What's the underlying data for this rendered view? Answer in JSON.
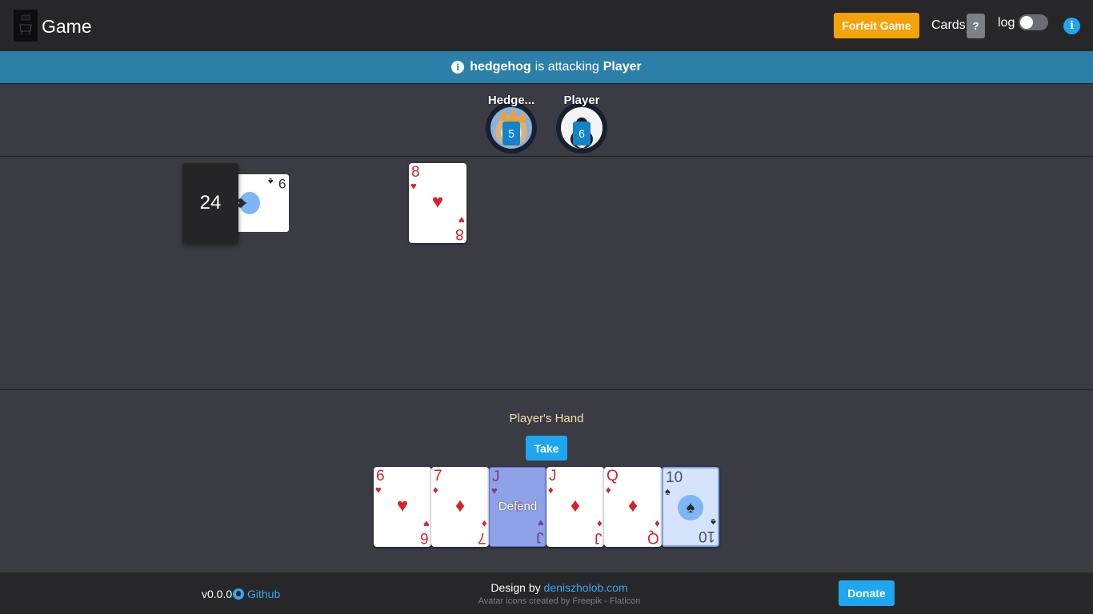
{
  "header": {
    "title": "Game",
    "forfeit_label": "Forfeit Game",
    "cards_label": "Cards",
    "cards_help": "?",
    "log_label": "log",
    "log_enabled": false,
    "info_icon": "info-icon"
  },
  "status": {
    "icon": "info-icon",
    "attacker": "hedgehog",
    "middle": "is attacking",
    "defender": "Player"
  },
  "players": [
    {
      "name": "Hedge...",
      "cards": "5",
      "avatar": "hedgehog-avatar"
    },
    {
      "name": "Player",
      "cards": "6",
      "avatar": "penguin-avatar"
    }
  ],
  "table": {
    "deck_count": "24",
    "trump_suit": "♠",
    "trump_rank": "9",
    "played": [
      {
        "rank": "8",
        "suit": "♥",
        "color": "red"
      }
    ]
  },
  "hand": {
    "title": "Player's Hand",
    "take_label": "Take",
    "defend_label": "Defend",
    "cards": [
      {
        "rank": "6",
        "suit": "♥"
      },
      {
        "rank": "7",
        "suit": "♦"
      },
      {
        "rank": "J",
        "suit": "♥",
        "selected": true
      },
      {
        "rank": "J",
        "suit": "♦"
      },
      {
        "rank": "Q",
        "suit": "♦"
      },
      {
        "rank": "10",
        "suit": "♠",
        "trump": true
      }
    ]
  },
  "footer": {
    "version": "v0.0.0",
    "github_label": "Github",
    "design_prefix": "Design by",
    "design_link": "deniszholob.com",
    "credit": "Avatar icons created by Freepik - Flaticon",
    "donate_label": "Donate"
  }
}
